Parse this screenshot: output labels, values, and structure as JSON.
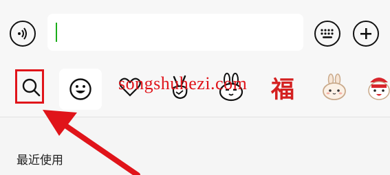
{
  "input_bar": {
    "voice_icon": "voice-icon",
    "text_value": "",
    "keyboard_icon": "keyboard-icon",
    "plus_icon": "plus-icon"
  },
  "emoji_tabs": [
    {
      "name": "search",
      "icon": "search-icon"
    },
    {
      "name": "emoji",
      "icon": "smiley-icon"
    },
    {
      "name": "favorites",
      "icon": "heart-icon"
    },
    {
      "name": "sticker-1",
      "icon": "victory-hand-icon"
    },
    {
      "name": "sticker-2",
      "icon": "rabbit-icon"
    },
    {
      "name": "sticker-3",
      "label": "福"
    },
    {
      "name": "sticker-4",
      "icon": "bunny-icon"
    },
    {
      "name": "sticker-5",
      "icon": "festive-character-icon"
    }
  ],
  "watermark": "songshuhezi.com",
  "recent_section": {
    "label": "最近使用"
  },
  "colors": {
    "highlight": "#e0141a",
    "caret": "#1aad19",
    "fu": "#d42020"
  }
}
